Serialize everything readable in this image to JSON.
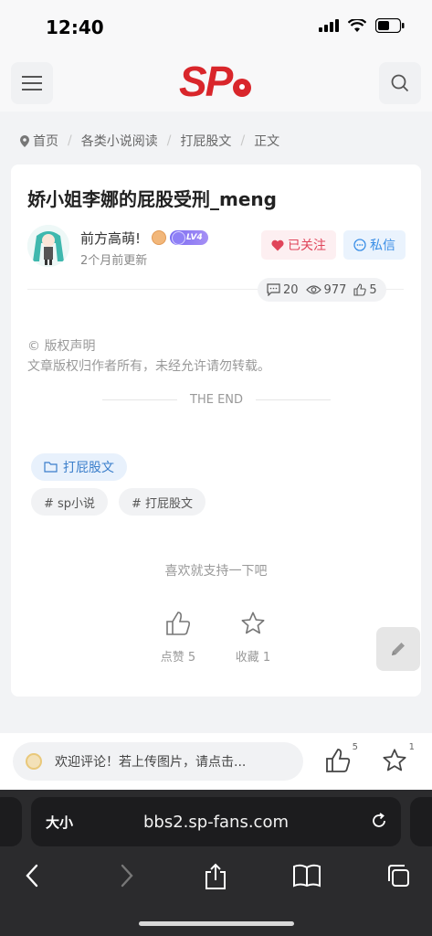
{
  "status": {
    "time": "12:40"
  },
  "breadcrumb": {
    "items": [
      "首页",
      "各类小说阅读",
      "打屁股文",
      "正文"
    ]
  },
  "article": {
    "title": "娇小姐李娜的屁股受刑_meng",
    "author": "前方高萌!",
    "level": "LV4",
    "updated": "2个月前更新",
    "follow_label": "已关注",
    "message_label": "私信",
    "stats": {
      "comments": "20",
      "views": "977",
      "likes": "5"
    },
    "copyright_title": "© 版权声明",
    "copyright_text": "文章版权归作者所有，未经允许请勿转载。",
    "the_end": "THE END",
    "category": "打屁股文",
    "tags": [
      "# sp小说",
      "# 打屁股文"
    ],
    "support_text": "喜欢就支持一下吧",
    "like_label": "点赞 5",
    "fav_label": "收藏 1"
  },
  "comment_bar": {
    "placeholder": "欢迎评论！若上传图片，请点击...",
    "like_count": "5",
    "fav_count": "1"
  },
  "browser": {
    "text_size": "大小",
    "url": "bbs2.sp-fans.com"
  },
  "colors": {
    "brand": "#d9262b",
    "follow": "#e0455a",
    "message": "#3a8ee6"
  }
}
